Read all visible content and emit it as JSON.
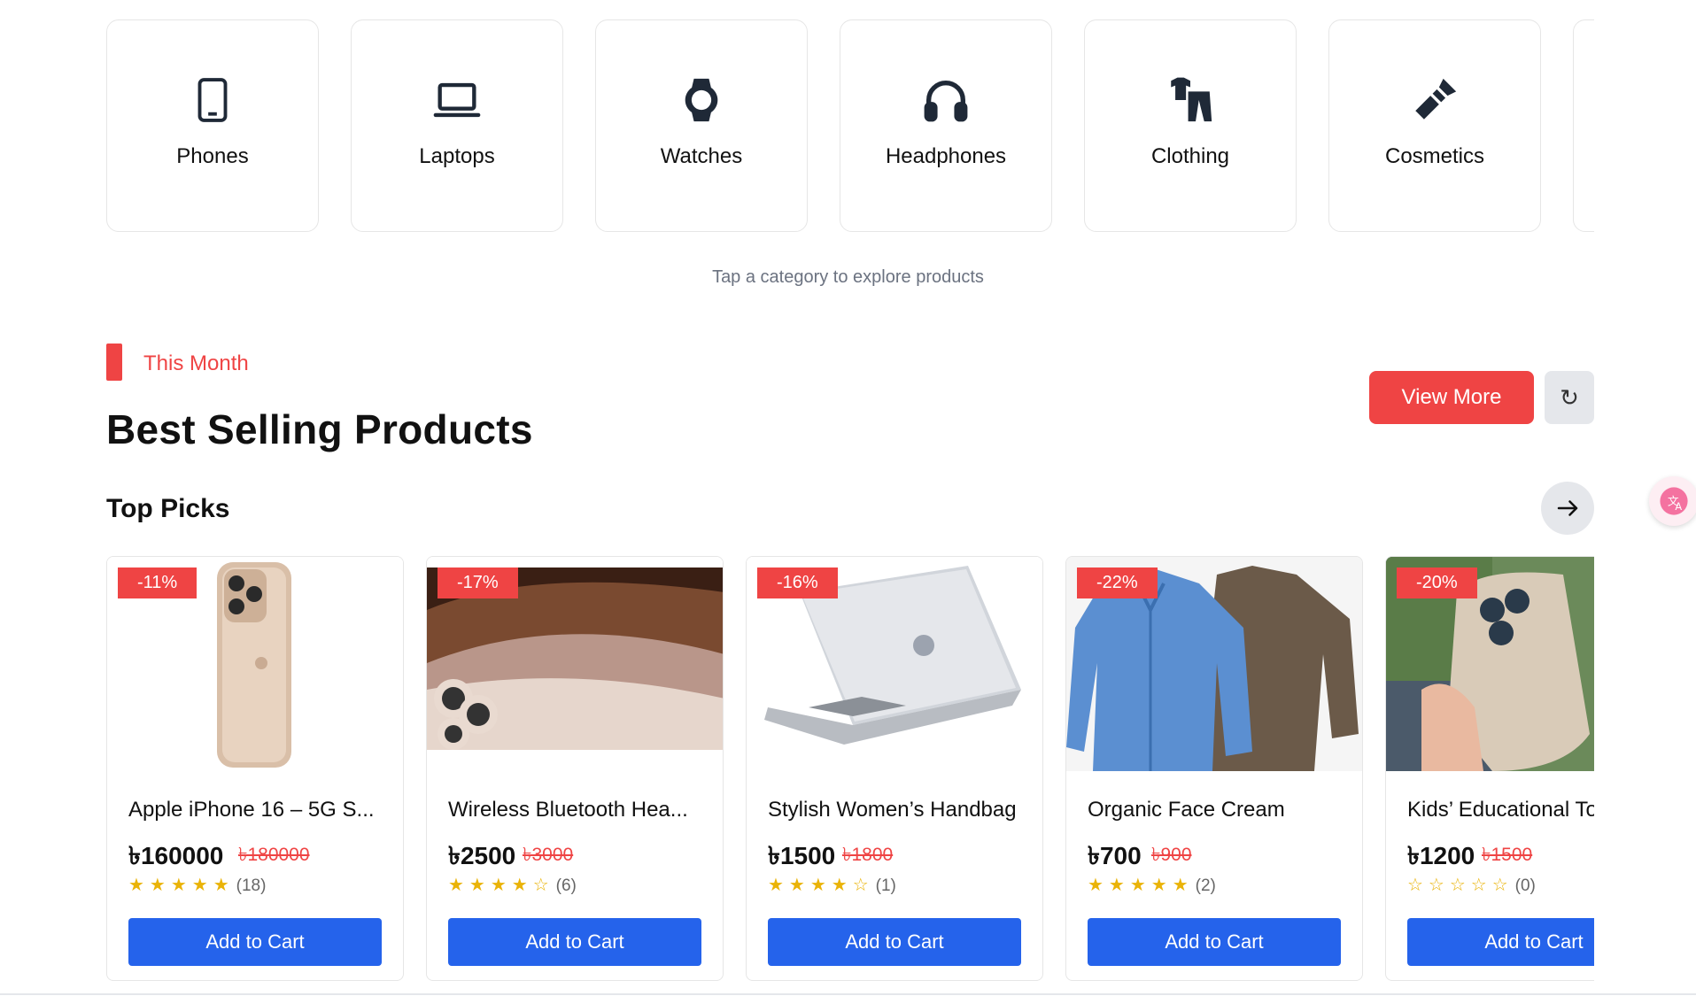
{
  "categories": {
    "items": [
      {
        "label": "Phones",
        "icon": "phone-icon"
      },
      {
        "label": "Laptops",
        "icon": "laptop-icon"
      },
      {
        "label": "Watches",
        "icon": "watch-icon"
      },
      {
        "label": "Headphones",
        "icon": "headphones-icon"
      },
      {
        "label": "Clothing",
        "icon": "clothing-icon"
      },
      {
        "label": "Cosmetics",
        "icon": "lipstick-icon"
      }
    ],
    "hint": "Tap a category to explore products"
  },
  "section": {
    "kicker": "This Month",
    "title": "Best Selling Products",
    "view_more": "View More",
    "refresh_glyph": "↻",
    "subtitle": "Top Picks"
  },
  "products": [
    {
      "name": "Apple iPhone 16 – 5G S...",
      "price": "৳160000",
      "old_price": "৳180000",
      "discount": "-11%",
      "rating": 5,
      "reviews": "(18)",
      "cart": "Add to Cart"
    },
    {
      "name": "Wireless Bluetooth Hea...",
      "price": "৳2500",
      "old_price": "৳3000",
      "discount": "-17%",
      "rating": 4,
      "reviews": "(6)",
      "cart": "Add to Cart"
    },
    {
      "name": "Stylish Women’s Handbag",
      "price": "৳1500",
      "old_price": "৳1800",
      "discount": "-16%",
      "rating": 4,
      "reviews": "(1)",
      "cart": "Add to Cart"
    },
    {
      "name": "Organic Face Cream",
      "price": "৳700",
      "old_price": "৳900",
      "discount": "-22%",
      "rating": 5,
      "reviews": "(2)",
      "cart": "Add to Cart"
    },
    {
      "name": "Kids’ Educational To",
      "price": "৳1200",
      "old_price": "৳1500",
      "discount": "-20%",
      "rating": 0,
      "reviews": "(0)",
      "cart": "Add to Cart"
    }
  ],
  "colors": {
    "accent": "#ef4444",
    "primary": "#2563eb",
    "star": "#eab308"
  }
}
